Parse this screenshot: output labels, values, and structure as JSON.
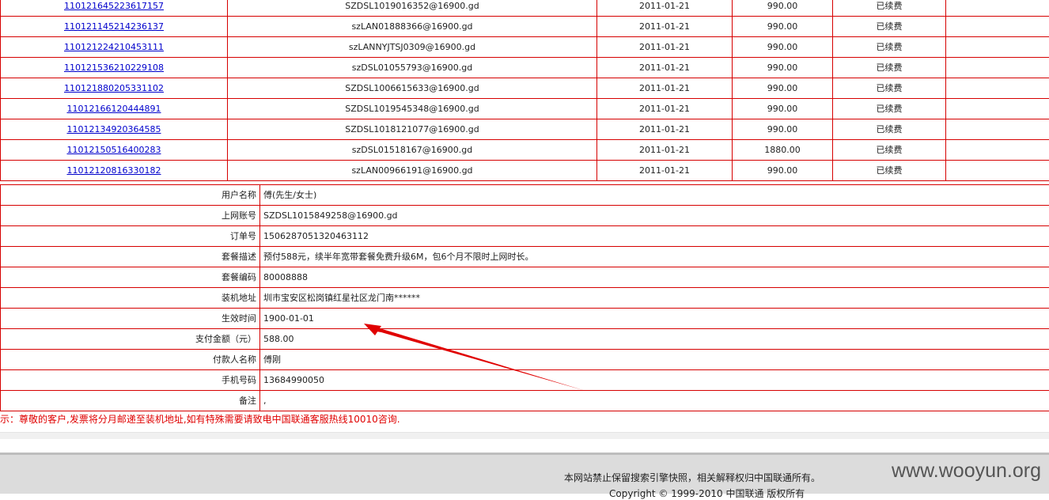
{
  "orders": [
    {
      "order_no": "110121645223617157",
      "account": "SZDSL1019016352@16900.gd",
      "date": "2011-01-21",
      "amount": "990.00",
      "status": "已续费"
    },
    {
      "order_no": "110121145214236137",
      "account": "szLAN01888366@16900.gd",
      "date": "2011-01-21",
      "amount": "990.00",
      "status": "已续费"
    },
    {
      "order_no": "110121224210453111",
      "account": "szLANNYJTSJ0309@16900.gd",
      "date": "2011-01-21",
      "amount": "990.00",
      "status": "已续费"
    },
    {
      "order_no": "110121536210229108",
      "account": "szDSL01055793@16900.gd",
      "date": "2011-01-21",
      "amount": "990.00",
      "status": "已续费"
    },
    {
      "order_no": "110121880205331102",
      "account": "SZDSL1006615633@16900.gd",
      "date": "2011-01-21",
      "amount": "990.00",
      "status": "已续费"
    },
    {
      "order_no": "11012166120444891",
      "account": "SZDSL1019545348@16900.gd",
      "date": "2011-01-21",
      "amount": "990.00",
      "status": "已续费"
    },
    {
      "order_no": "11012134920364585",
      "account": "SZDSL1018121077@16900.gd",
      "date": "2011-01-21",
      "amount": "990.00",
      "status": "已续费"
    },
    {
      "order_no": "11012150516400283",
      "account": "szDSL01518167@16900.gd",
      "date": "2011-01-21",
      "amount": "1880.00",
      "status": "已续费"
    },
    {
      "order_no": "11012120816330182",
      "account": "szLAN00966191@16900.gd",
      "date": "2011-01-21",
      "amount": "990.00",
      "status": "已续费"
    }
  ],
  "details": [
    {
      "label": "用户名称",
      "value": "傅(先生/女士)"
    },
    {
      "label": "上网账号",
      "value": "SZDSL1015849258@16900.gd"
    },
    {
      "label": "订单号",
      "value": "1506287051320463112"
    },
    {
      "label": "套餐描述",
      "value": "预付588元，续半年宽带套餐免费升级6M，包6个月不限时上网时长。"
    },
    {
      "label": "套餐编码",
      "value": "80008888"
    },
    {
      "label": "装机地址",
      "value": "圳市宝安区松岗镇红星社区龙门南******"
    },
    {
      "label": "生效时间",
      "value": "1900-01-01"
    },
    {
      "label": "支付金额（元）",
      "value": "588.00"
    },
    {
      "label": "付款人名称",
      "value": "傅刚"
    },
    {
      "label": "手机号码",
      "value": "13684990050"
    },
    {
      "label": "备注",
      "value": ","
    }
  ],
  "notice": "示：尊敬的客户,发票将分月邮递至装机地址,如有特殊需要请致电中国联通客服热线10010咨询.",
  "footer": {
    "line1": "本网站禁止保留搜索引擎快照，相关解释权归中国联通所有。",
    "line2": "Copyright © 1999-2010 中国联通 版权所有"
  },
  "watermark": "www.wooyun.org",
  "colors": {
    "border": "#d60000",
    "link": "#0000cc",
    "notice": "#e00000",
    "arrow": "#e00000"
  }
}
